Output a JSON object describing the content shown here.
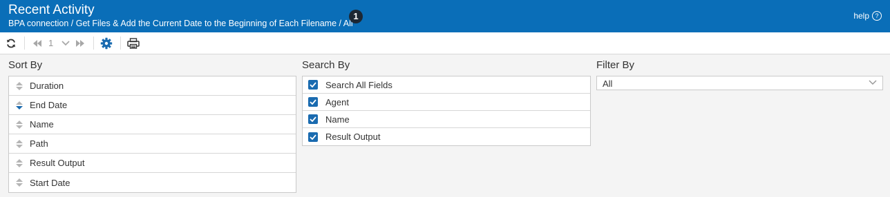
{
  "header": {
    "title": "Recent Activity",
    "breadcrumb": "BPA connection / Get Files & Add the Current Date to the Beginning of Each Filename / All",
    "badge_count": "1",
    "help_label": "help",
    "background_color": "#0a6eb8"
  },
  "toolbar": {
    "refresh_icon": "refresh-icon",
    "first_page_icon": "first-page-icon",
    "page_number": "1",
    "page_dropdown_icon": "chevron-down-icon",
    "last_page_icon": "last-page-icon",
    "settings_icon": "gear-icon",
    "print_icon": "printer-icon"
  },
  "sort_by": {
    "title": "Sort By",
    "items": [
      {
        "label": "Duration",
        "state": "none"
      },
      {
        "label": "End Date",
        "state": "descending"
      },
      {
        "label": "Name",
        "state": "none"
      },
      {
        "label": "Path",
        "state": "none"
      },
      {
        "label": "Result Output",
        "state": "none"
      },
      {
        "label": "Start Date",
        "state": "none"
      }
    ]
  },
  "search_by": {
    "title": "Search By",
    "items": [
      {
        "label": "Search All Fields",
        "checked": true
      },
      {
        "label": "Agent",
        "checked": true
      },
      {
        "label": "Name",
        "checked": true
      },
      {
        "label": "Result Output",
        "checked": true
      }
    ]
  },
  "filter_by": {
    "title": "Filter By",
    "selected": "All"
  },
  "colors": {
    "accent": "#1a6bb0",
    "active_sort": "#1a6bb0",
    "inactive_sort": "#b5b5b5"
  }
}
